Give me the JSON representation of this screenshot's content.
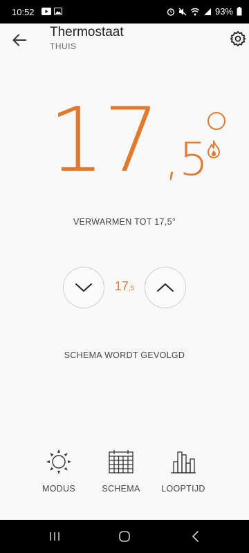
{
  "status_bar": {
    "time": "10:52",
    "battery": "93%"
  },
  "header": {
    "title": "Thermostaat",
    "subtitle": "THUIS",
    "back_icon": "arrow-left-icon",
    "settings_icon": "gear-icon"
  },
  "temperature": {
    "current_integer": "17",
    "current_decimal": ",5",
    "heat_status": "VERWARMEN TOT 17,5°",
    "setpoint_integer": "17",
    "setpoint_decimal": ",5",
    "schedule_status": "SCHEMA WORDT GEVOLGD"
  },
  "bottom_nav": {
    "items": [
      {
        "label": "MODUS",
        "icon": "sun-icon"
      },
      {
        "label": "SCHEMA",
        "icon": "calendar-icon"
      },
      {
        "label": "LOOPTIJD",
        "icon": "bar-chart-icon"
      }
    ]
  },
  "colors": {
    "accent": "#e07a2e",
    "background": "#f8f8f8",
    "text": "#222222"
  }
}
